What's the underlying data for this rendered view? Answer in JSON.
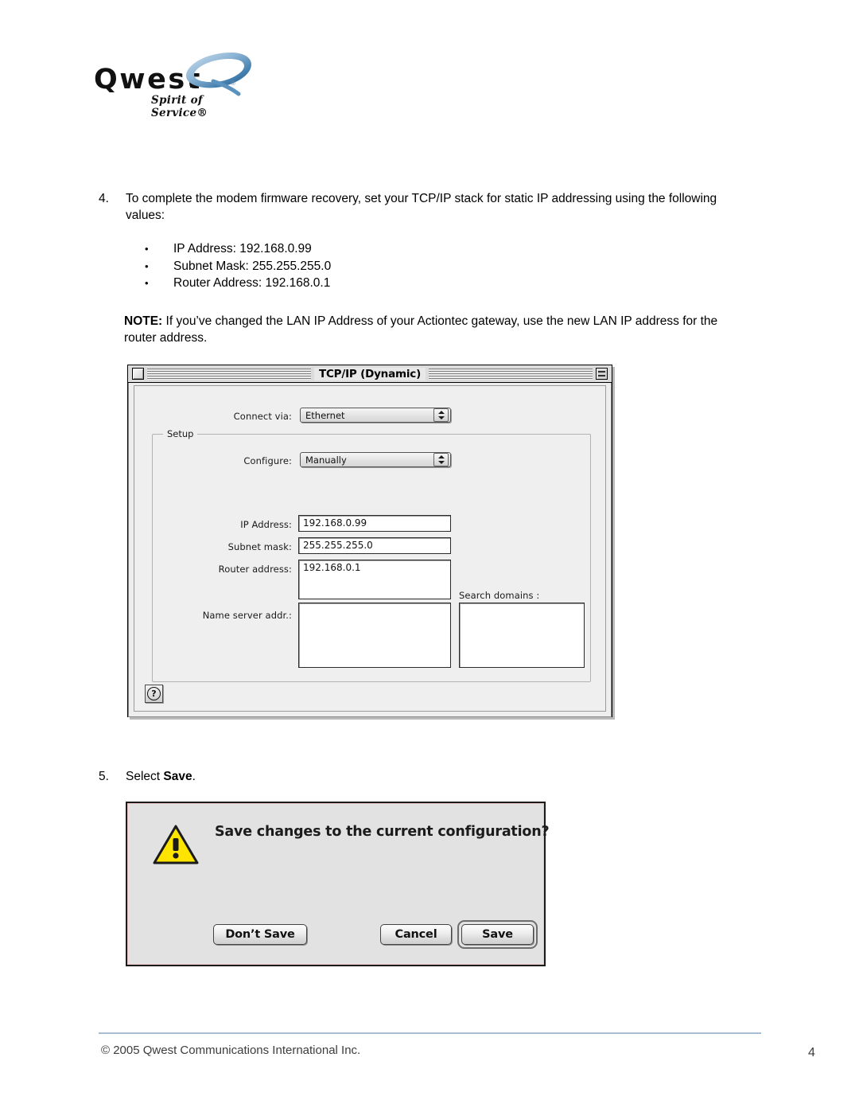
{
  "logo": {
    "wordmark": "Qwest",
    "wordmark_trademark": ".",
    "swoosh_trademark": "®",
    "tagline": "Spirit of Service®"
  },
  "steps": [
    {
      "number": "4.",
      "text": "To complete the modem firmware recovery, set your TCP/IP stack for static IP addressing using the following values:"
    },
    {
      "number": "5.",
      "text_before": "Select ",
      "bold": "Save",
      "text_after": "."
    }
  ],
  "bullets": [
    {
      "marker": "•",
      "text": "IP Address: 192.168.0.99"
    },
    {
      "marker": "•",
      "text": "Subnet Mask: 255.255.255.0"
    },
    {
      "marker": "•",
      "text": "Router Address: 192.168.0.1"
    }
  ],
  "note": {
    "label": "NOTE:",
    "text": " If you’ve changed the LAN IP Address of your Actiontec gateway, use the new LAN IP address for the router address."
  },
  "tcpip_window": {
    "title": "TCP/IP (Dynamic)",
    "close_icon": "close-box",
    "collapse_icon": "collapse-box",
    "connect_via": {
      "label": "Connect via:",
      "value": "Ethernet"
    },
    "setup_group_label": "Setup",
    "configure": {
      "label": "Configure:",
      "value": "Manually"
    },
    "fields": [
      {
        "label": "IP Address:",
        "value": "192.168.0.99"
      },
      {
        "label": "Subnet mask:",
        "value": "255.255.255.0"
      },
      {
        "label": "Router address:",
        "value": "192.168.0.1"
      },
      {
        "label": "Name server addr.:",
        "value": ""
      }
    ],
    "search_domains": {
      "label": "Search domains :",
      "value": ""
    },
    "help_button": "?"
  },
  "save_dialog": {
    "icon": "warning-triangle-icon",
    "message": "Save changes to the current configuration?",
    "buttons": {
      "dont_save": "Don’t Save",
      "cancel": "Cancel",
      "save": "Save"
    },
    "default_button": "Save"
  },
  "footer": {
    "copyright": "© 2005 Qwest Communications International Inc.",
    "page_number": "4"
  },
  "colors": {
    "footer_rule": "#a8bdd4",
    "warning_yellow": "#ffe400",
    "window_bg": "#efefef"
  }
}
